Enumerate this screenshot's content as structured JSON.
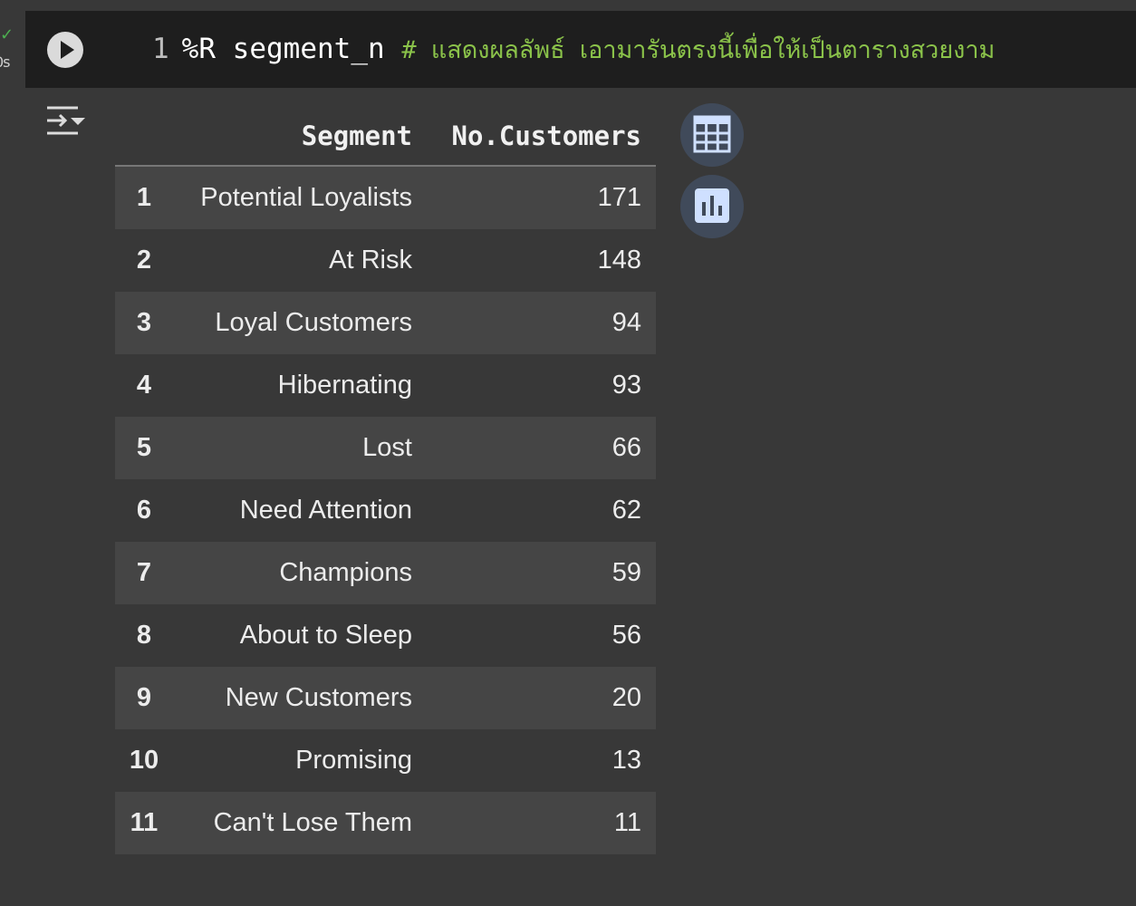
{
  "status": {
    "checkmark": "✓",
    "elapsed": "0s"
  },
  "code_cell": {
    "line_number": "1",
    "magic": "%R",
    "variable": "segment_n",
    "comment": "# แสดงผลลัพธ์ เอามารันตรงนี้เพื่อให้เป็นตารางสวยงาม"
  },
  "table": {
    "columns": [
      "Segment",
      "No.Customers"
    ],
    "rows": [
      {
        "index": "1",
        "segment": "Potential Loyalists",
        "count": "171"
      },
      {
        "index": "2",
        "segment": "At Risk",
        "count": "148"
      },
      {
        "index": "3",
        "segment": "Loyal Customers",
        "count": "94"
      },
      {
        "index": "4",
        "segment": "Hibernating",
        "count": "93"
      },
      {
        "index": "5",
        "segment": "Lost",
        "count": "66"
      },
      {
        "index": "6",
        "segment": "Need Attention",
        "count": "62"
      },
      {
        "index": "7",
        "segment": "Champions",
        "count": "59"
      },
      {
        "index": "8",
        "segment": "About to Sleep",
        "count": "56"
      },
      {
        "index": "9",
        "segment": "New Customers",
        "count": "20"
      },
      {
        "index": "10",
        "segment": "Promising",
        "count": "13"
      },
      {
        "index": "11",
        "segment": "Can't Lose Them",
        "count": "11"
      }
    ]
  },
  "icons": {
    "run": "play-icon",
    "output_toggle": "output-options-icon",
    "table_view": "table-icon",
    "chart_view": "bar-chart-icon"
  },
  "colors": {
    "background": "#383838",
    "code_background": "#1e1e1e",
    "comment": "#8bc34a",
    "row_alt": "#454545",
    "button_bg": "#404a5a",
    "button_icon": "#cfe0ff",
    "success": "#4caf50"
  }
}
